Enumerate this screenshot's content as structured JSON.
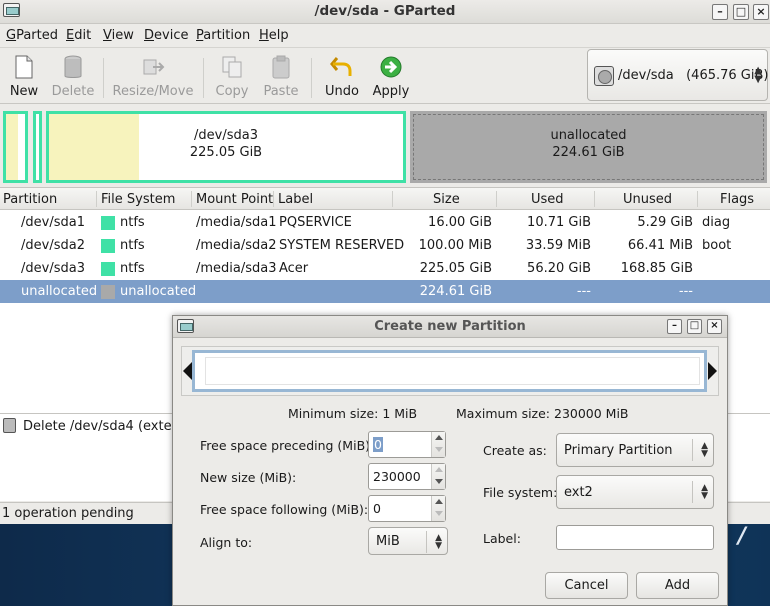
{
  "window": {
    "title": "/dev/sda - GParted"
  },
  "menu": [
    "GParted",
    "Edit",
    "View",
    "Device",
    "Partition",
    "Help"
  ],
  "toolbar": {
    "new": "New",
    "delete": "Delete",
    "resize": "Resize/Move",
    "copy": "Copy",
    "paste": "Paste",
    "undo": "Undo",
    "apply": "Apply"
  },
  "device_selector": {
    "device": "/dev/sda",
    "size": "(465.76 GiB)"
  },
  "diskmap": {
    "sda3": {
      "name": "/dev/sda3",
      "size": "225.05 GiB"
    },
    "unallocated": {
      "name": "unallocated",
      "size": "224.61 GiB"
    }
  },
  "table": {
    "headers": [
      "Partition",
      "File System",
      "Mount Point",
      "Label",
      "Size",
      "Used",
      "Unused",
      "Flags"
    ],
    "rows": [
      {
        "partition": "/dev/sda1",
        "fs": "ntfs",
        "mount": "/media/sda1",
        "label": "PQSERVICE",
        "size": "16.00 GiB",
        "used": "10.71 GiB",
        "unused": "5.29 GiB",
        "flags": "diag"
      },
      {
        "partition": "/dev/sda2",
        "fs": "ntfs",
        "mount": "/media/sda2",
        "label": "SYSTEM RESERVED",
        "size": "100.00 MiB",
        "used": "33.59 MiB",
        "unused": "66.41 MiB",
        "flags": "boot"
      },
      {
        "partition": "/dev/sda3",
        "fs": "ntfs",
        "mount": "/media/sda3",
        "label": "Acer",
        "size": "225.05 GiB",
        "used": "56.20 GiB",
        "unused": "168.85 GiB",
        "flags": ""
      },
      {
        "partition": "unallocated",
        "fs": "unallocated",
        "mount": "",
        "label": "",
        "size": "224.61 GiB",
        "used": "---",
        "unused": "---",
        "flags": ""
      }
    ]
  },
  "operations": {
    "item": "Delete /dev/sda4 (extende"
  },
  "status": "1 operation pending",
  "colors": {
    "ntfs": "#3fe1a6",
    "unallocated": "#a9a9a9",
    "selection": "#7d9ec9",
    "used": "#f7f3bd"
  },
  "dialog": {
    "title": "Create new Partition",
    "min_size": "Minimum size: 1 MiB",
    "max_size": "Maximum size: 230000 MiB",
    "free_preceding_label": "Free space preceding (MiB):",
    "free_preceding_value": "0",
    "new_size_label": "New size (MiB):",
    "new_size_value": "230000",
    "free_following_label": "Free space following (MiB):",
    "free_following_value": "0",
    "align_label": "Align to:",
    "align_value": "MiB",
    "create_as_label": "Create as:",
    "create_as_value": "Primary Partition",
    "filesystem_label": "File system:",
    "filesystem_value": "ext2",
    "label_label": "Label:",
    "label_value": "",
    "cancel": "Cancel",
    "add": "Add"
  }
}
